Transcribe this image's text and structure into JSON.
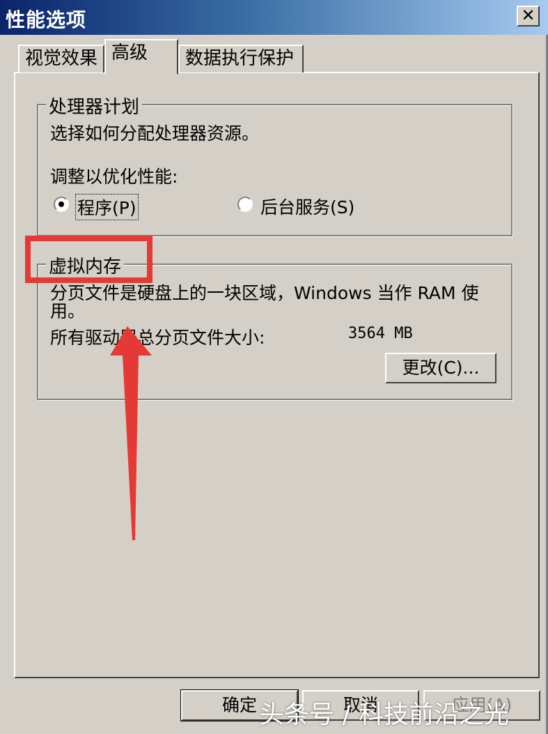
{
  "window": {
    "title": "性能选项",
    "close_glyph": "✕"
  },
  "tabs": [
    {
      "label": "视觉效果",
      "active": false
    },
    {
      "label": "高级",
      "active": true
    },
    {
      "label": "数据执行保护",
      "active": false
    }
  ],
  "processor": {
    "legend": "处理器计划",
    "description": "选择如何分配处理器资源。",
    "adjust_label": "调整以优化性能:",
    "options": [
      {
        "label": "程序(P)",
        "selected": true
      },
      {
        "label": "后台服务(S)",
        "selected": false
      }
    ]
  },
  "virtual_memory": {
    "legend": "虚拟内存",
    "description_line1": "分页文件是硬盘上的一块区域，Windows 当作 RAM 使",
    "description_line2": "用。",
    "total_label": "所有驱动器总分页文件大小:",
    "total_value": "3564 MB",
    "change_button": "更改(C)..."
  },
  "footer": {
    "ok": "确定",
    "cancel": "取消",
    "apply": "应用(A)"
  },
  "annotations": {
    "highlight_color": "#e53935",
    "watermark": "头条号 / 科技前沿之光"
  }
}
